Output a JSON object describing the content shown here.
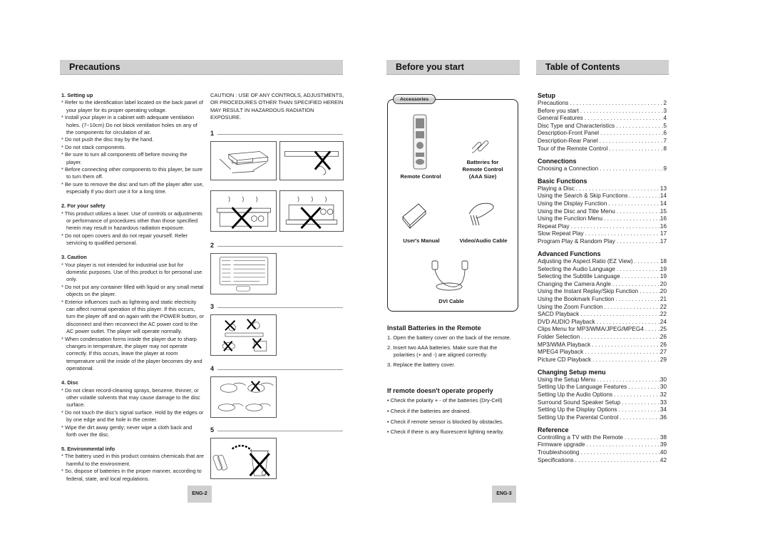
{
  "headers": {
    "precautions": "Precautions",
    "before_you_start": "Before you start",
    "toc": "Table of Contents"
  },
  "precautions": {
    "sections": [
      {
        "title": "1. Setting up",
        "items": [
          "Refer to the identification label located on the back panel of your player for its proper operating voltage.",
          "Install your player in a cabinet with adequate ventilation holes. (7~10cm) Do not block ventilation holes on any of the components for circulation of air.",
          "Do not push the disc tray by the hand.",
          "Do not stack components.",
          "Be sure to turn all components off before moving the player.",
          "Before connecting other components to this player, be sure to turn them off.",
          "Be sure to remove the disc and turn off the player after use, especially if you don't use it for a long time."
        ]
      },
      {
        "title": "2. For your safety",
        "items": [
          "This product utilizes a laser. Use of controls or adjustments or performance of procedures other than those specified herein may result in hazardous radiation exposure.",
          "Do not open covers and do not repair yourself. Refer servicing to qualified personal."
        ]
      },
      {
        "title": "3. Caution",
        "items": [
          "Your player is not intended for industrial use but for domestic purposes. Use of this product is for personal use only.",
          "Do not put any container filled with liquid or any small metal objects on the player.",
          "Exterior influences such as lightning and static electricity can affect normal operation of this player. If this occurs, turn the player off and on again with the POWER button, or disconnect and then reconnect the AC power cord to the AC power outlet. The player will operate normally.",
          "When condensation forms inside the player due to sharp changes in temperature, the player may not operate correctly. If this occurs, leave the player at room temperature until the inside of the player becomes dry and operational."
        ]
      },
      {
        "title": "4. Disc",
        "items": [
          "Do not clean record-cleaning sprays, benzene, thinner, or other volatile solvents that may cause damage to the disc surface.",
          "Do not touch the disc's signal surface. Hold by the edges or by one edge and the hole in the center.",
          "Wipe the dirt away gently; never wipe a cloth back and forth over the disc."
        ]
      },
      {
        "title": "5. Environmental info",
        "items": [
          "The battery used in this product contains chemicals that are harmful to the environment.",
          "So, dispose of batteries in the proper manner, according to federal, state, and local regulations."
        ]
      }
    ],
    "caution_notice": "CAUTION : USE OF ANY CONTROLS, ADJUSTMENTS, OR PROCEDURES OTHER THAN SPECIFIED HEREIN MAY RESULT IN HAZARDOUS RADIATION EXPOSURE.",
    "figures": [
      "1",
      "2",
      "3",
      "4",
      "5"
    ]
  },
  "before_you_start": {
    "accessories_label": "Accessories",
    "accessories": {
      "remote": "Remote Control",
      "batteries": "Batteries for Remote Control (AAA Size)",
      "manual": "User's Manual",
      "av_cable": "Video/Audio Cable",
      "dvi_cable": "DVI Cable"
    },
    "install_title": "Install Batteries in the Remote",
    "install_steps": [
      "1. Open the battery cover on the back of the remote.",
      "2. Insert two AAA batteries. Make sure that the polarities (+ and -) are aligned correctly.",
      "3. Replace the battery cover."
    ],
    "remote_title": "If remote doesn't operate properly",
    "remote_checks": [
      "Check the polarity + - of the batteries (Dry-Cell)",
      "Check if the batteries are drained.",
      "Check if remote sensor is blocked by obstacles.",
      "Check if there is any fluorescent lighting nearby."
    ]
  },
  "toc": [
    {
      "title": "Setup",
      "entries": [
        {
          "t": "Precautions",
          "p": "2"
        },
        {
          "t": "Before you start",
          "p": "3"
        },
        {
          "t": "General Features",
          "p": "4"
        },
        {
          "t": "Disc Type and Characteristics",
          "p": "5"
        },
        {
          "t": "Description-Front Panel",
          "p": "6"
        },
        {
          "t": "Description-Rear Panel",
          "p": "7"
        },
        {
          "t": "Tour of the Remote Control",
          "p": "8"
        }
      ]
    },
    {
      "title": "Connections",
      "entries": [
        {
          "t": "Choosing a Connection",
          "p": "9"
        }
      ]
    },
    {
      "title": "Basic Functions",
      "entries": [
        {
          "t": "Playing a Disc",
          "p": "13"
        },
        {
          "t": "Using the Search & Skip Functions",
          "p": "14"
        },
        {
          "t": "Using the Display Function",
          "p": "14"
        },
        {
          "t": "Using the Disc and Title Menu",
          "p": "15"
        },
        {
          "t": "Using the Function Menu",
          "p": "16"
        },
        {
          "t": "Repeat Play",
          "p": "16"
        },
        {
          "t": "Slow Repeat Play",
          "p": "17"
        },
        {
          "t": "Program Play & Random Play",
          "p": "17"
        }
      ]
    },
    {
      "title": "Advanced Functions",
      "entries": [
        {
          "t": "Adjusting the Aspect Ratio (EZ View)",
          "p": "18"
        },
        {
          "t": "Selecting the Audio Language",
          "p": "19"
        },
        {
          "t": "Selecting the Subtitle Language",
          "p": "19"
        },
        {
          "t": "Changing the Camera Angle",
          "p": "20"
        },
        {
          "t": "Using the Instant Replay/Skip Function",
          "p": "20"
        },
        {
          "t": "Using the Bookmark Function",
          "p": "21"
        },
        {
          "t": "Using the Zoom Function",
          "p": "22"
        },
        {
          "t": "SACD Playback",
          "p": "22"
        },
        {
          "t": "DVD AUDIO Playback",
          "p": "24"
        },
        {
          "t": "Clips Menu for MP3/WMA/JPEG/MPEG4",
          "p": "25"
        },
        {
          "t": "Folder Selection",
          "p": "26"
        },
        {
          "t": "MP3/WMA Playback",
          "p": "26"
        },
        {
          "t": "MPEG4 Playback",
          "p": "27"
        },
        {
          "t": "Picture CD Playback",
          "p": "29"
        }
      ]
    },
    {
      "title": "Changing Setup menu",
      "entries": [
        {
          "t": "Using the Setup Menu",
          "p": "30"
        },
        {
          "t": "Setting Up the Language Features",
          "p": "30"
        },
        {
          "t": "Setting Up the Audio Options",
          "p": "32"
        },
        {
          "t": "Surround Sound Speaker Setup",
          "p": "33"
        },
        {
          "t": "Setting Up the Display Options",
          "p": "34"
        },
        {
          "t": "Setting Up the Parental Control",
          "p": "36"
        }
      ]
    },
    {
      "title": "Reference",
      "entries": [
        {
          "t": "Controlling a TV with the Remote",
          "p": "38"
        },
        {
          "t": "Firmware upgrade",
          "p": "39"
        },
        {
          "t": "Troubleshooting",
          "p": "40"
        },
        {
          "t": "Specifications",
          "p": "42"
        }
      ]
    }
  ],
  "page_numbers": {
    "left": "ENG-2",
    "right": "ENG-3"
  }
}
